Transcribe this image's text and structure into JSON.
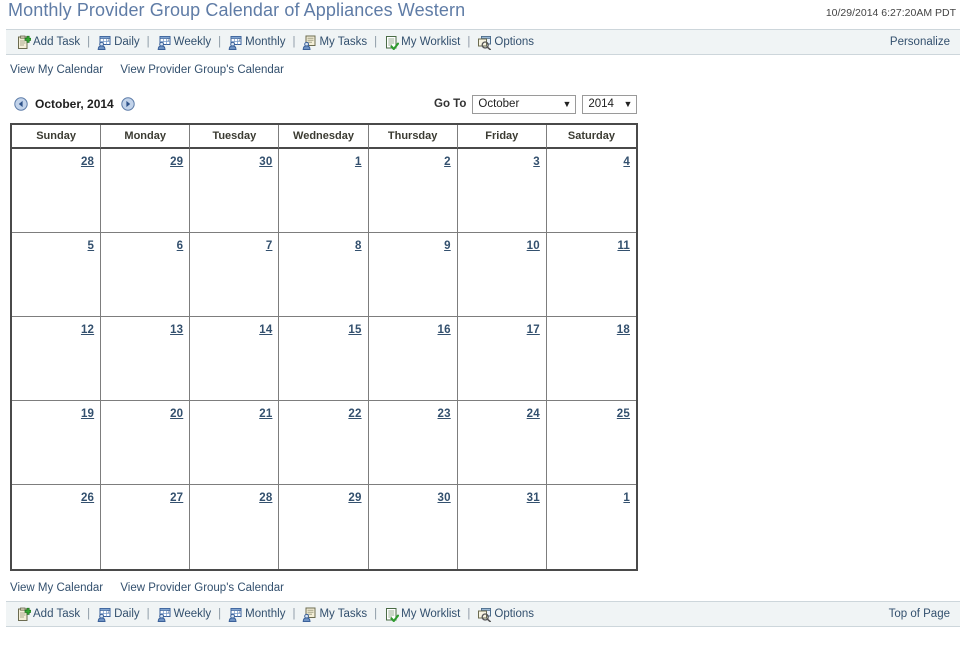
{
  "header": {
    "title": "Monthly Provider Group Calendar of Appliances Western",
    "timestamp": "10/29/2014 6:27:20AM PDT"
  },
  "toolbar": {
    "items": [
      {
        "label": "Add Task",
        "icon": "clipboard-add-icon"
      },
      {
        "label": "Daily",
        "icon": "calendar-person-icon"
      },
      {
        "label": "Weekly",
        "icon": "calendar-person-icon"
      },
      {
        "label": "Monthly",
        "icon": "calendar-person-icon"
      },
      {
        "label": "My Tasks",
        "icon": "tasks-person-icon"
      },
      {
        "label": "My Worklist",
        "icon": "worklist-check-icon"
      },
      {
        "label": "Options",
        "icon": "options-window-icon"
      }
    ],
    "separator": "|",
    "personalize_label": "Personalize",
    "top_of_page_label": "Top of Page"
  },
  "nav_links": {
    "view_my_calendar": "View My Calendar",
    "view_group_calendar": "View Provider Group's Calendar"
  },
  "month_nav": {
    "prev_icon": "arrow-left-circle-icon",
    "next_icon": "arrow-right-circle-icon",
    "current_month_label": "October, 2014"
  },
  "goto": {
    "label": "Go To",
    "month_value": "October",
    "year_value": "2014",
    "caret": "▼"
  },
  "calendar": {
    "day_headers": [
      "Sunday",
      "Monday",
      "Tuesday",
      "Wednesday",
      "Thursday",
      "Friday",
      "Saturday"
    ],
    "weeks": [
      [
        {
          "day": "28",
          "type": "other"
        },
        {
          "day": "29",
          "type": "other"
        },
        {
          "day": "30",
          "type": "other"
        },
        {
          "day": "1",
          "type": "normal"
        },
        {
          "day": "2",
          "type": "normal"
        },
        {
          "day": "3",
          "type": "normal"
        },
        {
          "day": "4",
          "type": "weekend"
        }
      ],
      [
        {
          "day": "5",
          "type": "weekend"
        },
        {
          "day": "6",
          "type": "normal"
        },
        {
          "day": "7",
          "type": "normal"
        },
        {
          "day": "8",
          "type": "normal"
        },
        {
          "day": "9",
          "type": "normal"
        },
        {
          "day": "10",
          "type": "normal"
        },
        {
          "day": "11",
          "type": "weekend"
        }
      ],
      [
        {
          "day": "12",
          "type": "weekend"
        },
        {
          "day": "13",
          "type": "normal"
        },
        {
          "day": "14",
          "type": "normal"
        },
        {
          "day": "15",
          "type": "normal"
        },
        {
          "day": "16",
          "type": "normal"
        },
        {
          "day": "17",
          "type": "normal"
        },
        {
          "day": "18",
          "type": "weekend"
        }
      ],
      [
        {
          "day": "19",
          "type": "weekend"
        },
        {
          "day": "20",
          "type": "normal"
        },
        {
          "day": "21",
          "type": "normal"
        },
        {
          "day": "22",
          "type": "normal"
        },
        {
          "day": "23",
          "type": "normal"
        },
        {
          "day": "24",
          "type": "normal"
        },
        {
          "day": "25",
          "type": "weekend"
        }
      ],
      [
        {
          "day": "26",
          "type": "weekend"
        },
        {
          "day": "27",
          "type": "normal"
        },
        {
          "day": "28",
          "type": "normal"
        },
        {
          "day": "29",
          "type": "today"
        },
        {
          "day": "30",
          "type": "normal"
        },
        {
          "day": "31",
          "type": "normal"
        },
        {
          "day": "1",
          "type": "other"
        }
      ]
    ]
  },
  "colors": {
    "title": "#5f7ca6",
    "link": "#33506e",
    "toolbar_bg": "#f0f4f5",
    "other_month_cell": "#d4d7da",
    "weekend_cell": "#e7e7dc",
    "today_cell": "#ccd8ec",
    "table_border": "#4a4a4a"
  }
}
